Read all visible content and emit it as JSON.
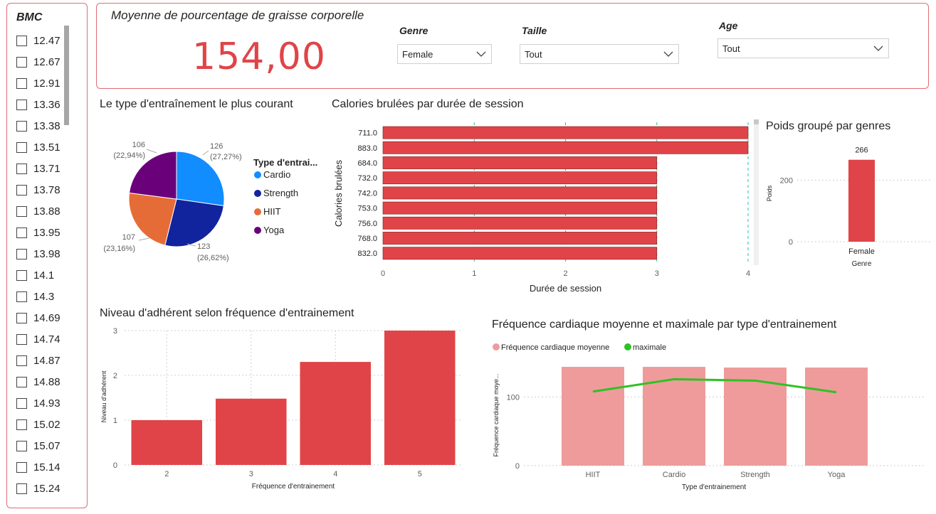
{
  "bmc": {
    "title": "BMC",
    "items": [
      "12.47",
      "12.67",
      "12.91",
      "13.36",
      "13.38",
      "13.51",
      "13.71",
      "13.78",
      "13.88",
      "13.95",
      "13.98",
      "14.1",
      "14.3",
      "14.69",
      "14.74",
      "14.87",
      "14.88",
      "14.93",
      "15.02",
      "15.07",
      "15.14",
      "15.24"
    ]
  },
  "kpi": {
    "title": "Moyenne de pourcentage de graisse corporelle",
    "value": "154,00"
  },
  "filters": {
    "genre": {
      "label": "Genre",
      "value": "Female"
    },
    "taille": {
      "label": "Taille",
      "value": "Tout"
    },
    "age": {
      "label": "Age",
      "value": "Tout"
    }
  },
  "pie": {
    "title": "Le type d'entraînement le plus courant",
    "legend_title": "Type d'entrai...",
    "chart_data": {
      "type": "pie",
      "slices": [
        {
          "name": "Cardio",
          "value": 126,
          "label": "126",
          "pct": "(27,27%)",
          "color": "#118dff"
        },
        {
          "name": "Strength",
          "value": 123,
          "label": "123",
          "pct": "(26,62%)",
          "color": "#12239e"
        },
        {
          "name": "HIIT",
          "value": 107,
          "label": "107",
          "pct": "(23,16%)",
          "color": "#e66c37"
        },
        {
          "name": "Yoga",
          "value": 106,
          "label": "106",
          "pct": "(22,94%)",
          "color": "#6b007b"
        }
      ]
    }
  },
  "calories": {
    "title": "Calories brulées par durée de session",
    "chart_data": {
      "type": "bar",
      "orientation": "horizontal",
      "categories": [
        "711.0",
        "883.0",
        "684.0",
        "732.0",
        "742.0",
        "753.0",
        "756.0",
        "768.0",
        "832.0"
      ],
      "values": [
        4,
        4,
        3,
        3,
        3,
        3,
        3,
        3,
        3
      ],
      "xlabel": "Durée de session",
      "ylabel": "Calories brulées",
      "xlim": [
        0,
        4
      ],
      "xticks": [
        "0",
        "1",
        "2",
        "3",
        "4"
      ],
      "color": "#e04448"
    }
  },
  "poids": {
    "title": "Poids groupé par genres",
    "chart_data": {
      "type": "bar",
      "categories": [
        "Female"
      ],
      "values": [
        266
      ],
      "data_labels": [
        "266"
      ],
      "xlabel": "Genre",
      "ylabel": "Poids",
      "ylim": [
        0,
        300
      ],
      "yticks": [
        "0",
        "200"
      ],
      "color": "#e04448"
    }
  },
  "adherent": {
    "title": "Niveau d'adhérent selon fréquence d'entrainement",
    "chart_data": {
      "type": "bar",
      "categories": [
        "2",
        "3",
        "4",
        "5"
      ],
      "values": [
        1.0,
        1.48,
        2.3,
        3.0
      ],
      "xlabel": "Fréquence d'entrainement",
      "ylabel": "Niveau d'adhérent",
      "ylim": [
        0,
        3
      ],
      "yticks": [
        "0",
        "1",
        "2",
        "3"
      ],
      "color": "#e04448"
    }
  },
  "frequence": {
    "title": "Fréquence cardiaque moyenne et maximale par type d'entrainement",
    "legend": [
      {
        "label": "Fréquence cardiaque moyenne",
        "color": "#ef9b9b"
      },
      {
        "label": "maximale",
        "color": "#2dc225"
      }
    ],
    "chart_data": {
      "type": "bar",
      "categories": [
        "HIIT",
        "Cardio",
        "Strength",
        "Yoga"
      ],
      "series": [
        {
          "name": "Fréquence cardiaque moyenne",
          "values": [
            144,
            144,
            143,
            143
          ]
        },
        {
          "name": "maximale",
          "values": [
            108,
            126,
            124,
            107
          ]
        }
      ],
      "xlabel": "Type d'entrainement",
      "ylabel": "Fréquence cardiaque moye...",
      "ylim": [
        0,
        200
      ],
      "yticks": [
        "0",
        "100"
      ]
    }
  }
}
